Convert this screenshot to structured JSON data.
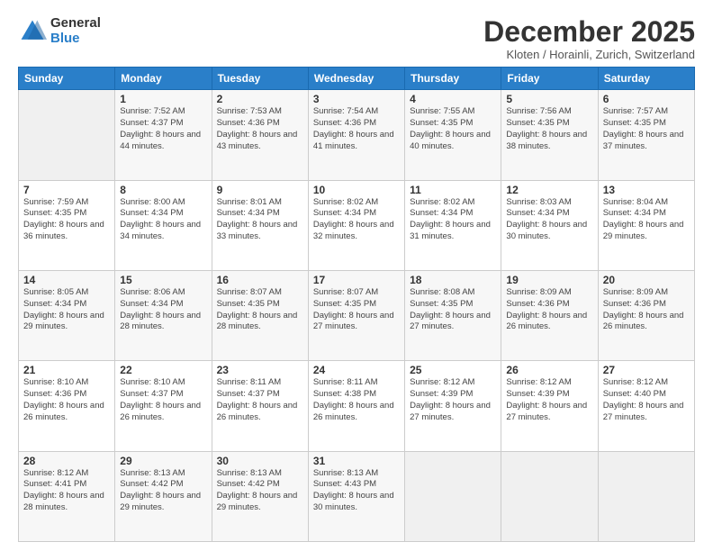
{
  "logo": {
    "general": "General",
    "blue": "Blue"
  },
  "header": {
    "month_title": "December 2025",
    "subtitle": "Kloten / Horainli, Zurich, Switzerland"
  },
  "weekdays": [
    "Sunday",
    "Monday",
    "Tuesday",
    "Wednesday",
    "Thursday",
    "Friday",
    "Saturday"
  ],
  "weeks": [
    [
      {
        "day": "",
        "sunrise": "",
        "sunset": "",
        "daylight": ""
      },
      {
        "day": "1",
        "sunrise": "Sunrise: 7:52 AM",
        "sunset": "Sunset: 4:37 PM",
        "daylight": "Daylight: 8 hours and 44 minutes."
      },
      {
        "day": "2",
        "sunrise": "Sunrise: 7:53 AM",
        "sunset": "Sunset: 4:36 PM",
        "daylight": "Daylight: 8 hours and 43 minutes."
      },
      {
        "day": "3",
        "sunrise": "Sunrise: 7:54 AM",
        "sunset": "Sunset: 4:36 PM",
        "daylight": "Daylight: 8 hours and 41 minutes."
      },
      {
        "day": "4",
        "sunrise": "Sunrise: 7:55 AM",
        "sunset": "Sunset: 4:35 PM",
        "daylight": "Daylight: 8 hours and 40 minutes."
      },
      {
        "day": "5",
        "sunrise": "Sunrise: 7:56 AM",
        "sunset": "Sunset: 4:35 PM",
        "daylight": "Daylight: 8 hours and 38 minutes."
      },
      {
        "day": "6",
        "sunrise": "Sunrise: 7:57 AM",
        "sunset": "Sunset: 4:35 PM",
        "daylight": "Daylight: 8 hours and 37 minutes."
      }
    ],
    [
      {
        "day": "7",
        "sunrise": "Sunrise: 7:59 AM",
        "sunset": "Sunset: 4:35 PM",
        "daylight": "Daylight: 8 hours and 36 minutes."
      },
      {
        "day": "8",
        "sunrise": "Sunrise: 8:00 AM",
        "sunset": "Sunset: 4:34 PM",
        "daylight": "Daylight: 8 hours and 34 minutes."
      },
      {
        "day": "9",
        "sunrise": "Sunrise: 8:01 AM",
        "sunset": "Sunset: 4:34 PM",
        "daylight": "Daylight: 8 hours and 33 minutes."
      },
      {
        "day": "10",
        "sunrise": "Sunrise: 8:02 AM",
        "sunset": "Sunset: 4:34 PM",
        "daylight": "Daylight: 8 hours and 32 minutes."
      },
      {
        "day": "11",
        "sunrise": "Sunrise: 8:02 AM",
        "sunset": "Sunset: 4:34 PM",
        "daylight": "Daylight: 8 hours and 31 minutes."
      },
      {
        "day": "12",
        "sunrise": "Sunrise: 8:03 AM",
        "sunset": "Sunset: 4:34 PM",
        "daylight": "Daylight: 8 hours and 30 minutes."
      },
      {
        "day": "13",
        "sunrise": "Sunrise: 8:04 AM",
        "sunset": "Sunset: 4:34 PM",
        "daylight": "Daylight: 8 hours and 29 minutes."
      }
    ],
    [
      {
        "day": "14",
        "sunrise": "Sunrise: 8:05 AM",
        "sunset": "Sunset: 4:34 PM",
        "daylight": "Daylight: 8 hours and 29 minutes."
      },
      {
        "day": "15",
        "sunrise": "Sunrise: 8:06 AM",
        "sunset": "Sunset: 4:34 PM",
        "daylight": "Daylight: 8 hours and 28 minutes."
      },
      {
        "day": "16",
        "sunrise": "Sunrise: 8:07 AM",
        "sunset": "Sunset: 4:35 PM",
        "daylight": "Daylight: 8 hours and 28 minutes."
      },
      {
        "day": "17",
        "sunrise": "Sunrise: 8:07 AM",
        "sunset": "Sunset: 4:35 PM",
        "daylight": "Daylight: 8 hours and 27 minutes."
      },
      {
        "day": "18",
        "sunrise": "Sunrise: 8:08 AM",
        "sunset": "Sunset: 4:35 PM",
        "daylight": "Daylight: 8 hours and 27 minutes."
      },
      {
        "day": "19",
        "sunrise": "Sunrise: 8:09 AM",
        "sunset": "Sunset: 4:36 PM",
        "daylight": "Daylight: 8 hours and 26 minutes."
      },
      {
        "day": "20",
        "sunrise": "Sunrise: 8:09 AM",
        "sunset": "Sunset: 4:36 PM",
        "daylight": "Daylight: 8 hours and 26 minutes."
      }
    ],
    [
      {
        "day": "21",
        "sunrise": "Sunrise: 8:10 AM",
        "sunset": "Sunset: 4:36 PM",
        "daylight": "Daylight: 8 hours and 26 minutes."
      },
      {
        "day": "22",
        "sunrise": "Sunrise: 8:10 AM",
        "sunset": "Sunset: 4:37 PM",
        "daylight": "Daylight: 8 hours and 26 minutes."
      },
      {
        "day": "23",
        "sunrise": "Sunrise: 8:11 AM",
        "sunset": "Sunset: 4:37 PM",
        "daylight": "Daylight: 8 hours and 26 minutes."
      },
      {
        "day": "24",
        "sunrise": "Sunrise: 8:11 AM",
        "sunset": "Sunset: 4:38 PM",
        "daylight": "Daylight: 8 hours and 26 minutes."
      },
      {
        "day": "25",
        "sunrise": "Sunrise: 8:12 AM",
        "sunset": "Sunset: 4:39 PM",
        "daylight": "Daylight: 8 hours and 27 minutes."
      },
      {
        "day": "26",
        "sunrise": "Sunrise: 8:12 AM",
        "sunset": "Sunset: 4:39 PM",
        "daylight": "Daylight: 8 hours and 27 minutes."
      },
      {
        "day": "27",
        "sunrise": "Sunrise: 8:12 AM",
        "sunset": "Sunset: 4:40 PM",
        "daylight": "Daylight: 8 hours and 27 minutes."
      }
    ],
    [
      {
        "day": "28",
        "sunrise": "Sunrise: 8:12 AM",
        "sunset": "Sunset: 4:41 PM",
        "daylight": "Daylight: 8 hours and 28 minutes."
      },
      {
        "day": "29",
        "sunrise": "Sunrise: 8:13 AM",
        "sunset": "Sunset: 4:42 PM",
        "daylight": "Daylight: 8 hours and 29 minutes."
      },
      {
        "day": "30",
        "sunrise": "Sunrise: 8:13 AM",
        "sunset": "Sunset: 4:42 PM",
        "daylight": "Daylight: 8 hours and 29 minutes."
      },
      {
        "day": "31",
        "sunrise": "Sunrise: 8:13 AM",
        "sunset": "Sunset: 4:43 PM",
        "daylight": "Daylight: 8 hours and 30 minutes."
      },
      {
        "day": "",
        "sunrise": "",
        "sunset": "",
        "daylight": ""
      },
      {
        "day": "",
        "sunrise": "",
        "sunset": "",
        "daylight": ""
      },
      {
        "day": "",
        "sunrise": "",
        "sunset": "",
        "daylight": ""
      }
    ]
  ]
}
